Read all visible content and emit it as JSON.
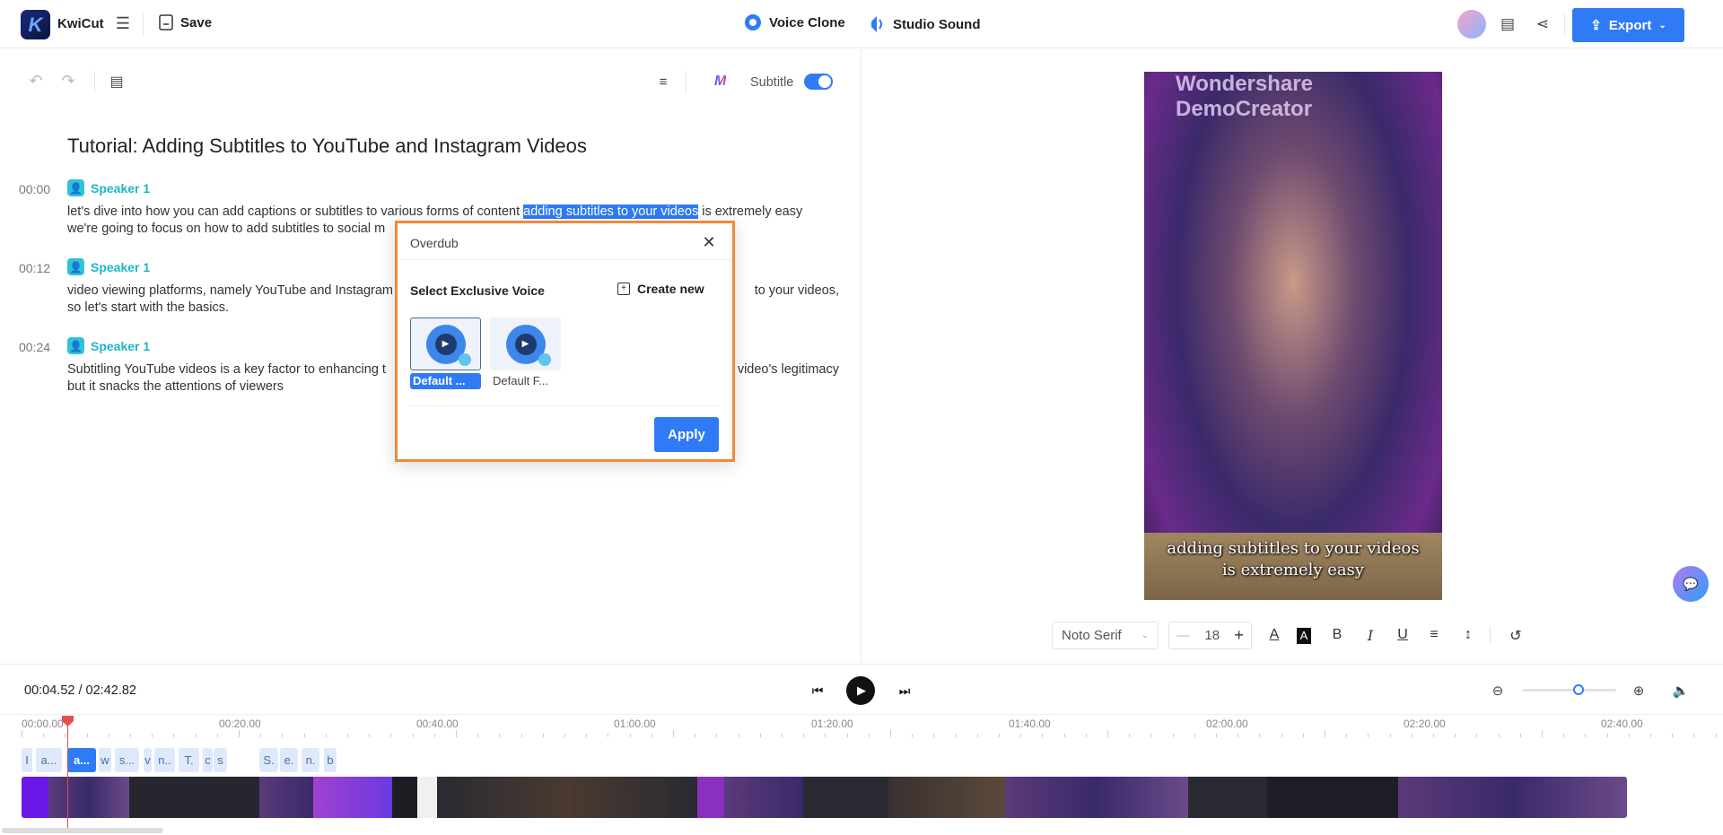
{
  "header": {
    "app_name": "KwiCut",
    "logo_letter": "K",
    "save_label": "Save",
    "voice_clone_label": "Voice Clone",
    "studio_sound_label": "Studio Sound",
    "export_label": "Export",
    "accent": "#2f7bf5"
  },
  "toolbar": {
    "subtitle_label": "Subtitle",
    "subtitle_on": true
  },
  "transcript": {
    "title": "Tutorial: Adding Subtitles to YouTube and Instagram Videos",
    "blocks": [
      {
        "time": "00:00",
        "speaker": "Speaker 1",
        "line1_left": "let's dive into how you can add captions or subtitles to various forms of content ",
        "line1_highlight": "adding subtitles to your videos",
        "line1_after": " is extremely easy",
        "line2_left": "we're going to focus on how to add subtitles to social m"
      },
      {
        "time": "00:12",
        "speaker": "Speaker 1",
        "line1_left": "video viewing platforms, namely YouTube and Instagram",
        "line1_right": "to your videos,",
        "line2_left": "so let's start with the basics."
      },
      {
        "time": "00:24",
        "speaker": "Speaker 1",
        "line1_left": "Subtitling YouTube videos is a key factor to enhancing t",
        "line1_right": "video's legitimacy",
        "line2_left": "but it snacks the attentions of viewers"
      }
    ]
  },
  "dialog": {
    "title": "Overdub",
    "section_label": "Select Exclusive Voice",
    "create_new_label": "Create new",
    "voices": [
      {
        "label": "Default ...",
        "selected": true
      },
      {
        "label": "Default F...",
        "selected": false
      }
    ],
    "apply_label": "Apply"
  },
  "preview": {
    "watermark_line1": "Wondershare",
    "watermark_line2": "DemoCreator",
    "caption_line1": "adding subtitles to your videos",
    "caption_line2": "is extremely easy"
  },
  "format_bar": {
    "font": "Noto Serif",
    "size": "18"
  },
  "player": {
    "current_time": "00:04.52",
    "separator": " / ",
    "duration": "02:42.82",
    "zoom_level": 0.6
  },
  "timeline": {
    "ruler_labels": [
      "00:00.00",
      "00:20.00",
      "00:40.00",
      "01:00.00",
      "01:20.00",
      "01:40.00",
      "02:00.00",
      "02:20.00",
      "02:40.00"
    ],
    "word_chips": [
      {
        "text": "I"
      },
      {
        "text": "a..."
      },
      {
        "text": "a...",
        "selected": true
      },
      {
        "text": "w"
      },
      {
        "text": "s..."
      },
      {
        "text": "v"
      },
      {
        "text": "n.."
      },
      {
        "text": "T."
      },
      {
        "text": "c"
      },
      {
        "text": "s"
      },
      {
        "text": "S."
      },
      {
        "text": "e."
      },
      {
        "text": "n."
      },
      {
        "text": "b"
      }
    ]
  }
}
